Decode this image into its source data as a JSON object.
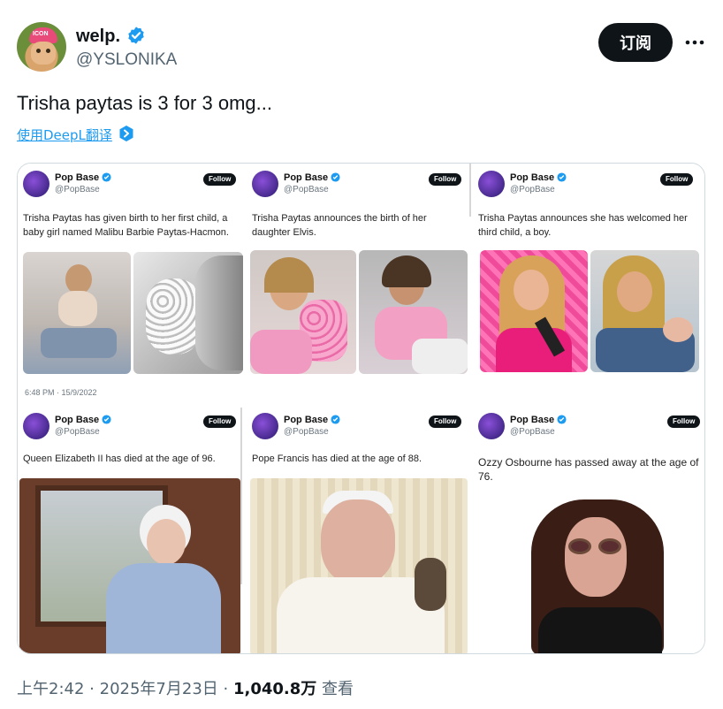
{
  "author": {
    "display_name": "welp.",
    "handle": "@YSLONIKA",
    "avatar_cap_text": "ICON"
  },
  "actions": {
    "subscribe_label": "订阅",
    "more_icon": "more-horizontal-icon"
  },
  "tweet": {
    "text": "Trisha paytas is 3 for 3 omg...",
    "translate_label": "使用DeepL翻译"
  },
  "embedded_posts": [
    {
      "account_name": "Pop Base",
      "account_handle": "@PopBase",
      "follow_label": "Follow",
      "text_lines": [
        "Trisha Paytas has given birth to her first child, a",
        "baby girl named Malibu Barbie Paytas-Hacmon."
      ],
      "timestamp": "6:48 PM · 15/9/2022"
    },
    {
      "account_name": "Pop Base",
      "account_handle": "@PopBase",
      "follow_label": "Follow",
      "text_lines": [
        "Trisha Paytas announces the birth of her",
        "daughter Elvis."
      ]
    },
    {
      "account_name": "Pop Base",
      "account_handle": "@PopBase",
      "follow_label": "Follow",
      "text_lines": [
        "Trisha Paytas announces she has welcomed her",
        "third child, a boy."
      ]
    },
    {
      "account_name": "Pop Base",
      "account_handle": "@PopBase",
      "follow_label": "Follow",
      "text_lines": [
        "Queen Elizabeth II has died at the age of 96."
      ]
    },
    {
      "account_name": "Pop Base",
      "account_handle": "@PopBase",
      "follow_label": "Follow",
      "text_lines": [
        "Pope Francis has died at the age of 88."
      ]
    },
    {
      "account_name": "Pop Base",
      "account_handle": "@PopBase",
      "follow_label": "Follow",
      "text_lines": [
        "Ozzy Osbourne has passed away at the age  of",
        "76."
      ]
    }
  ],
  "footer": {
    "time": "上午2:42",
    "sep1": "·",
    "date": "2025年7月23日",
    "sep2": "·",
    "views_count": "1,040.8万",
    "views_label": "查看"
  },
  "colors": {
    "link": "#1d9bf0",
    "verified": "#1d9bf0",
    "button_bg": "#0f1419",
    "secondary_text": "#536471"
  }
}
